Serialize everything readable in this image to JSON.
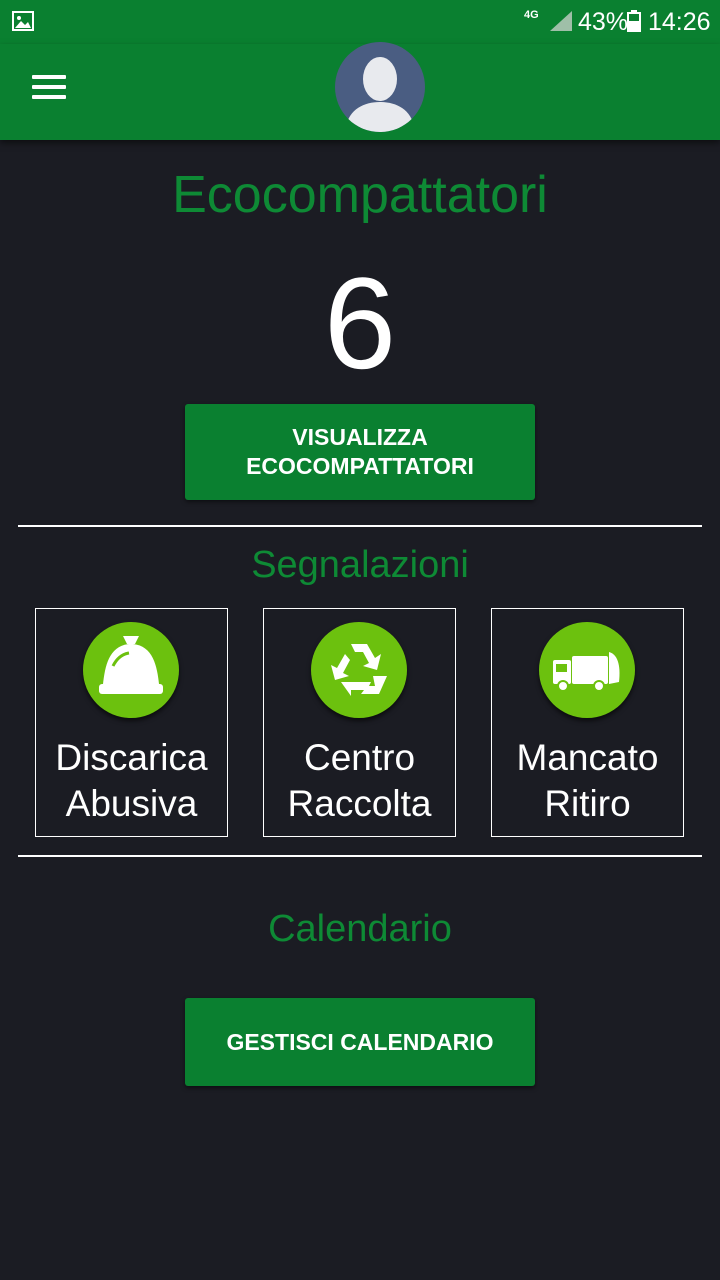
{
  "status_bar": {
    "network": "4G",
    "battery": "43%",
    "time": "14:26"
  },
  "header": {
    "menu_icon": "hamburger-menu-icon",
    "avatar_icon": "user-avatar-icon"
  },
  "ecocompattatori": {
    "title": "Ecocompattatori",
    "count": "6",
    "button_label": "VISUALIZZA\nECOCOMPATTATORI"
  },
  "segnalazioni": {
    "title": "Segnalazioni",
    "items": [
      {
        "label": "Discarica\nAbusiva",
        "icon": "garbage-bag-icon"
      },
      {
        "label": "Centro\nRaccolta",
        "icon": "recycle-icon"
      },
      {
        "label": "Mancato\nRitiro",
        "icon": "garbage-truck-icon"
      }
    ]
  },
  "calendario": {
    "title": "Calendario",
    "button_label": "GESTISCI CALENDARIO"
  },
  "colors": {
    "primary_green": "#0a8030",
    "title_green": "#0e8a35",
    "icon_green": "#6cc10e",
    "background": "#1b1c23"
  }
}
